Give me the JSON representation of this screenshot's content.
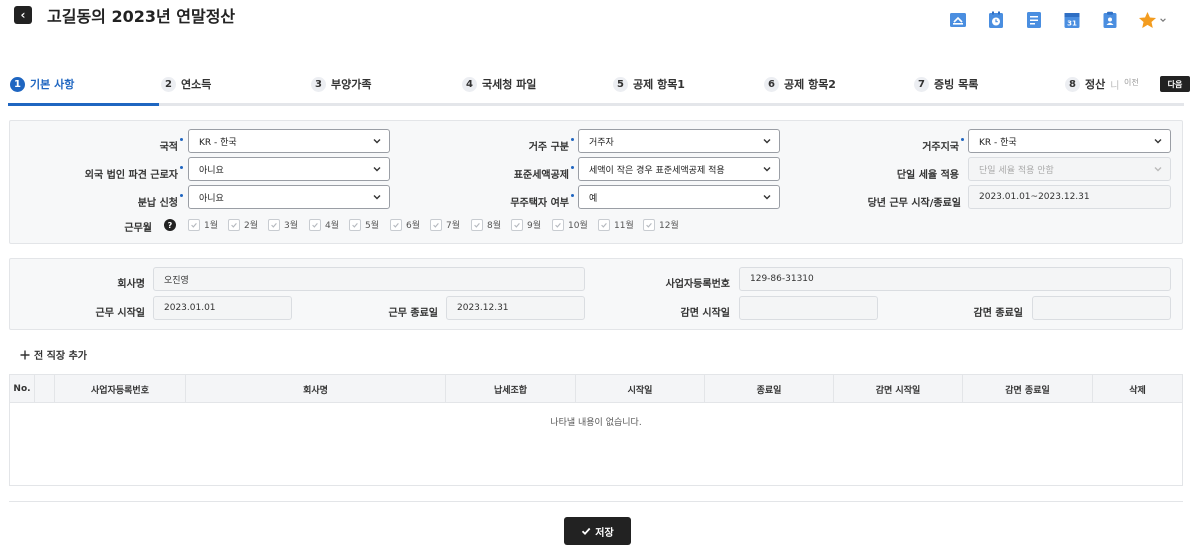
{
  "header": {
    "title": "고길동의 2023년 연말정산",
    "icons": [
      "mail-icon",
      "clock-icon",
      "document-icon",
      "calendar-icon",
      "clipboard-icon",
      "star-icon"
    ],
    "accent": "#1f66c1"
  },
  "steps": [
    {
      "num": "1",
      "label": "기본 사항",
      "active": true
    },
    {
      "num": "2",
      "label": "연소득"
    },
    {
      "num": "3",
      "label": "부양가족"
    },
    {
      "num": "4",
      "label": "국세청 파일"
    },
    {
      "num": "5",
      "label": "공제 항목1"
    },
    {
      "num": "6",
      "label": "공제 항목2"
    },
    {
      "num": "7",
      "label": "증빙 목록"
    },
    {
      "num": "8",
      "label": "정산",
      "fade": "니"
    }
  ],
  "nav": {
    "prev": "이전",
    "next": "다음"
  },
  "basic": {
    "nationality": {
      "label": "국적",
      "value": "KR - 한국"
    },
    "residence_type": {
      "label": "거주 구분",
      "value": "거주자"
    },
    "residence_region": {
      "label": "거주지국",
      "value": "KR - 한국"
    },
    "foreign_dispatch": {
      "label": "외국 법인 파견 근로자",
      "value": "아니요"
    },
    "standard_credit": {
      "label": "표준세액공제",
      "value": "세액이 작은 경우 표준세액공제 적용"
    },
    "flat_rate": {
      "label": "단일 세율 적용",
      "value": "단일 세율 적용 안함"
    },
    "installment": {
      "label": "분납 신청",
      "value": "아니요"
    },
    "homeless": {
      "label": "무주택자 여부",
      "value": "예"
    },
    "work_period": {
      "label": "당년 근무 시작/종료일",
      "value": "2023.01.01~2023.12.31"
    },
    "work_months_label": "근무월",
    "months": [
      "1월",
      "2월",
      "3월",
      "4월",
      "5월",
      "6월",
      "7월",
      "8월",
      "9월",
      "10월",
      "11월",
      "12월"
    ]
  },
  "company": {
    "name": {
      "label": "회사명",
      "value": "오진영"
    },
    "reg_no": {
      "label": "사업자등록번호",
      "value": "129-86-31310"
    },
    "start": {
      "label": "근무 시작일",
      "value": "2023.01.01"
    },
    "end": {
      "label": "근무 종료일",
      "value": "2023.12.31"
    },
    "reduce_start": {
      "label": "감면 시작일",
      "value": ""
    },
    "reduce_end": {
      "label": "감면 종료일",
      "value": ""
    }
  },
  "previous": {
    "add_label": "전 직장 추가",
    "columns": [
      "No.",
      "",
      "사업자등록번호",
      "회사명",
      "납세조합",
      "시작일",
      "종료일",
      "감면 시작일",
      "감면 종료일",
      "삭제"
    ],
    "empty_text": "나타낼 내용이 없습니다."
  },
  "save_label": "저장"
}
